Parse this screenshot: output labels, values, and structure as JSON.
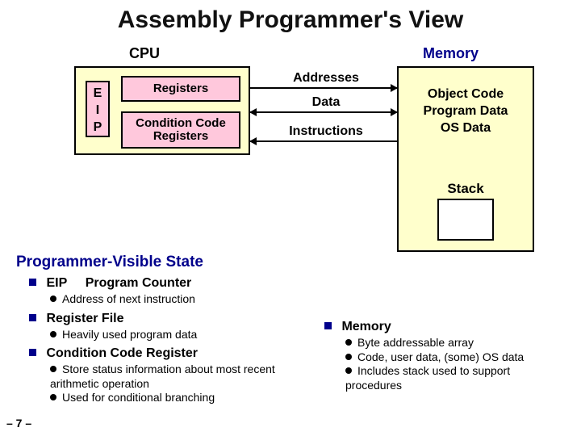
{
  "title": "Assembly Programmer's View",
  "diagram": {
    "cpu_label": "CPU",
    "memory_label": "Memory",
    "eip": "E\nI\nP",
    "registers": "Registers",
    "condition_codes": "Condition Code Registers",
    "bus": {
      "addresses": "Addresses",
      "data": "Data",
      "instructions": "Instructions"
    },
    "memory_lines": [
      "Object Code",
      "Program Data",
      "OS Data"
    ],
    "stack": "Stack"
  },
  "section_heading": "Programmer-Visible State",
  "items": [
    {
      "head_a": "EIP",
      "head_b": "Program Counter",
      "bullets": [
        "Address of next instruction"
      ]
    },
    {
      "head_a": "Register File",
      "head_b": "",
      "bullets": [
        "Heavily used program data"
      ]
    },
    {
      "head_a": "Condition Code Register",
      "head_b": "",
      "bullets": [
        "Store status information about most recent arithmetic operation",
        "Used for conditional branching"
      ]
    }
  ],
  "memory_item": {
    "head": "Memory",
    "bullets": [
      "Byte addressable array",
      "Code, user data, (some) OS data",
      "Includes stack used to support procedures"
    ]
  },
  "page_number": "– 7 –"
}
